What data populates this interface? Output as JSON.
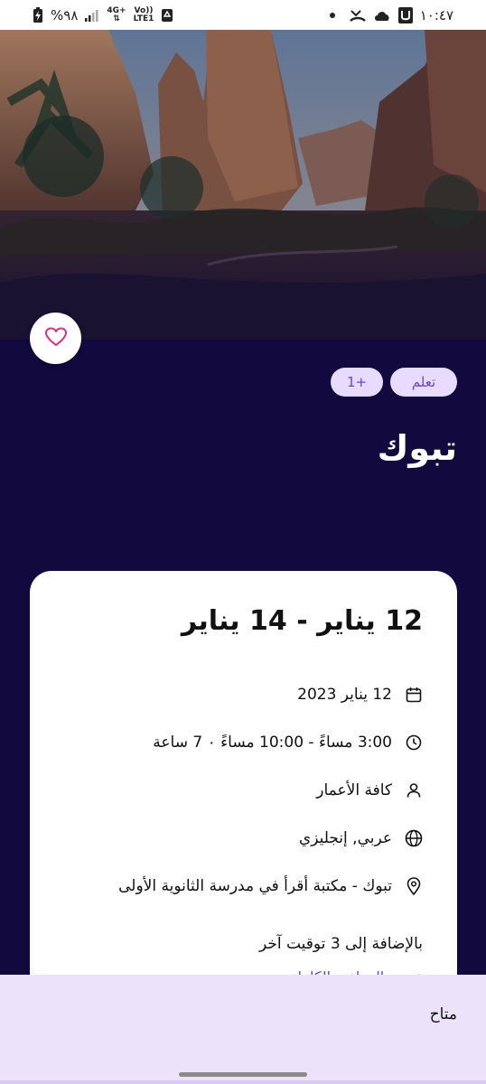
{
  "status_bar": {
    "time": "١٠:٤٧",
    "battery": "%٩٨",
    "network_top": "4G+",
    "network_vo": "Vo))",
    "network_lte": "LTE1"
  },
  "colors": {
    "background": "#12093f",
    "accent": "#6c45c9",
    "chip_bg": "#e7dcff",
    "heart": "#d6327a",
    "sheet_bg": "#ece3fb"
  },
  "event": {
    "tags": [
      "تعلم",
      "+1"
    ],
    "title": "تبوك"
  },
  "card": {
    "date_range": "12 يناير - 14 يناير",
    "details": [
      {
        "icon": "calendar-icon",
        "text": "12 يناير 2023"
      },
      {
        "icon": "clock-icon",
        "text": "3:00 مساءً - 10:00 مساءً ٠ 7 ساعة"
      },
      {
        "icon": "person-icon",
        "text": "كافة الأعمار"
      },
      {
        "icon": "globe-icon",
        "text": "عربي, إنجليزي"
      },
      {
        "icon": "location-pin-icon",
        "text": "تبوك - مكتبة أقرأ في مدرسة الثانوية الأولى"
      }
    ],
    "extra_times": "بالإضافة إلى 3 توقيت آخر",
    "more_link": "عرض المواعيد الكاملة"
  },
  "sheet": {
    "status": "متاح",
    "status_next": "متاح"
  }
}
